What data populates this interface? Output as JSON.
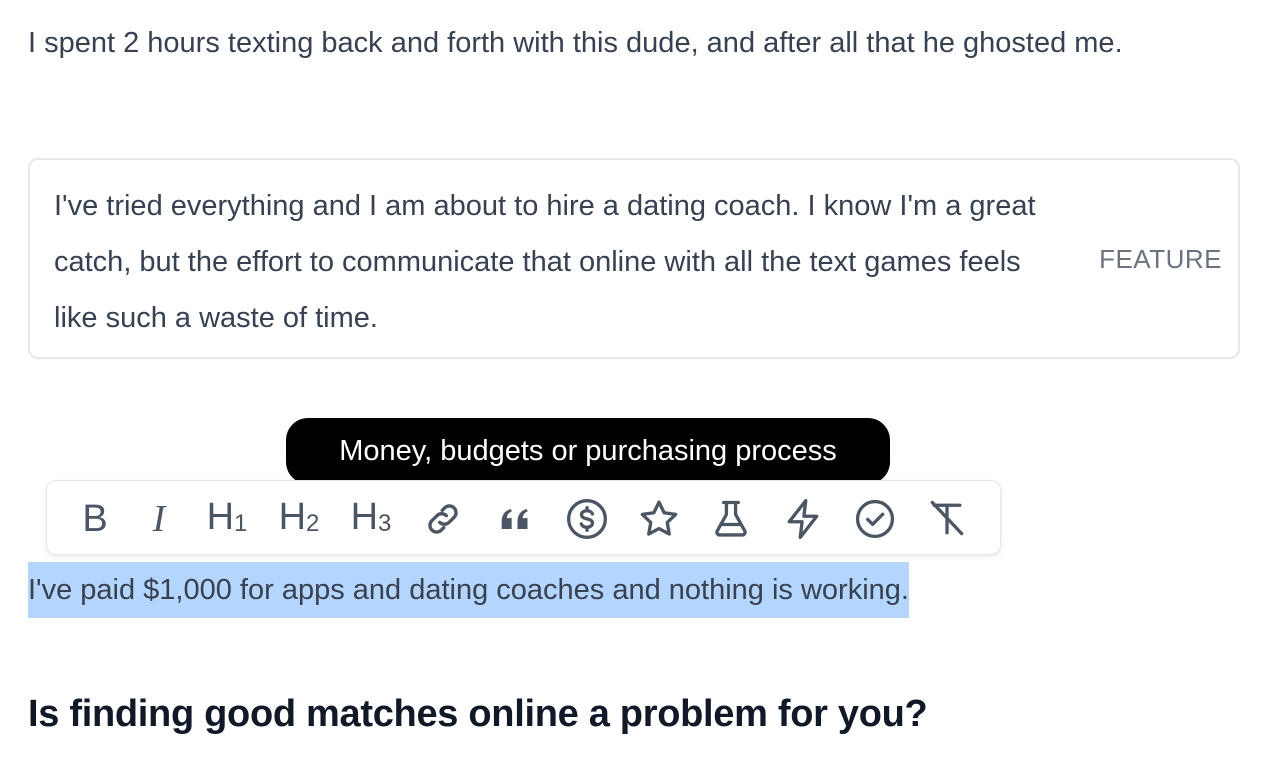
{
  "paragraphs": {
    "first": "I spent 2 hours texting back and forth with this dude, and after all that he ghosted me.",
    "selected": "I've paid $1,000 for apps and dating coaches and nothing is working."
  },
  "feature_block": {
    "text": "I've tried everything and I am about to hire a dating coach. I know I'm a great catch, but the effort to communicate that online with all the text games feels like such a waste of time.",
    "tag": "FEATURE"
  },
  "tooltip": {
    "text": "Money, budgets or purchasing process"
  },
  "toolbar": {
    "buttons": [
      {
        "icon": "bold-icon",
        "label": "B"
      },
      {
        "icon": "italic-icon",
        "label": "I"
      },
      {
        "icon": "heading1-icon",
        "label": "H",
        "sub": "1"
      },
      {
        "icon": "heading2-icon",
        "label": "H",
        "sub": "2"
      },
      {
        "icon": "heading3-icon",
        "label": "H",
        "sub": "3"
      },
      {
        "icon": "link-icon"
      },
      {
        "icon": "quote-icon"
      },
      {
        "icon": "dollar-circle-icon"
      },
      {
        "icon": "star-icon"
      },
      {
        "icon": "flask-icon"
      },
      {
        "icon": "lightning-icon"
      },
      {
        "icon": "check-circle-icon"
      },
      {
        "icon": "clear-format-icon"
      }
    ]
  },
  "heading": {
    "text": "Is finding good matches online a problem for you?"
  },
  "colors": {
    "selection": "#b4d5fe",
    "tooltip_bg": "#000000",
    "text": "#374151",
    "icon": "#4b5563"
  }
}
